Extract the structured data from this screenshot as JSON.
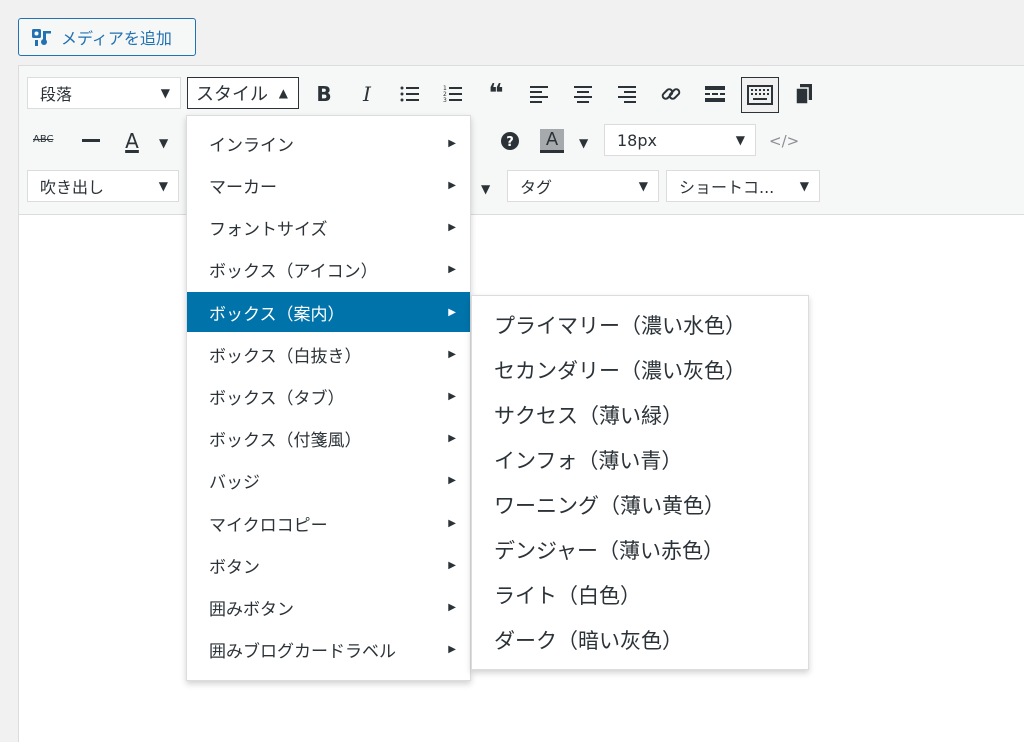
{
  "media": {
    "add_label": "メディアを追加"
  },
  "toolbar": {
    "format_select": "段落",
    "style_select": "スタイル",
    "font_size_select": "18px",
    "balloon_select": "吹き出し",
    "tag_select": "タグ",
    "shortcode_select": "ショートコ..."
  },
  "menu": {
    "items": [
      "インライン",
      "マーカー",
      "フォントサイズ",
      "ボックス（アイコン）",
      "ボックス（案内）",
      "ボックス（白抜き）",
      "ボックス（タブ）",
      "ボックス（付箋風）",
      "バッジ",
      "マイクロコピー",
      "ボタン",
      "囲みボタン",
      "囲みブログカードラベル"
    ],
    "active_index": 4
  },
  "submenu": {
    "items": [
      "プライマリー（濃い水色）",
      "セカンダリー（濃い灰色）",
      "サクセス（薄い緑）",
      "インフォ（薄い青）",
      "ワーニング（薄い黄色）",
      "デンジャー（薄い赤色）",
      "ライト（白色）",
      "ダーク（暗い灰色）"
    ]
  },
  "colors": {
    "accent": "#0073aa",
    "button_blue": "#2271b1",
    "toolbar_bg": "#f6f7f7",
    "page_bg": "#f1f1f1"
  }
}
